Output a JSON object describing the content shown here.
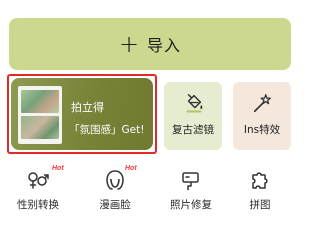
{
  "import": {
    "icon": "plus-icon",
    "label": "导入"
  },
  "feature_card": {
    "title": "拍立得",
    "subtitle": "「氛围感」Get!",
    "thumbnail": "polaroid-photo"
  },
  "tiles": [
    {
      "label": "复古滤镜",
      "icon": "paint-bucket-icon"
    },
    {
      "label": "Ins特效",
      "icon": "magic-wand-icon"
    }
  ],
  "tools": [
    {
      "label": "性别转换",
      "badge": "Hot",
      "icon": "gender-swap-icon"
    },
    {
      "label": "漫画脸",
      "badge": "Hot",
      "icon": "comic-face-icon"
    },
    {
      "label": "照片修复",
      "icon": "photo-repair-icon"
    },
    {
      "label": "拼图",
      "icon": "puzzle-icon"
    }
  ],
  "colors": {
    "accent": "#cdd88f",
    "card": "#788338",
    "highlight": "#e32a2a",
    "hot": "#ff3a3a"
  }
}
